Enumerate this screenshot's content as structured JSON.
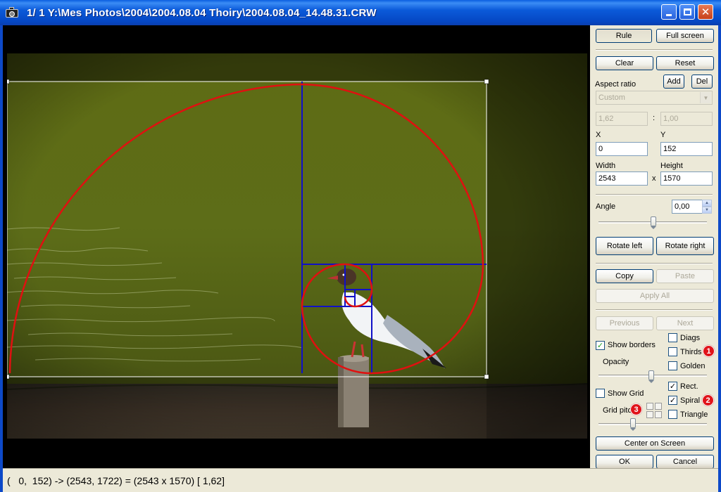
{
  "window": {
    "title": "1/  1  Y:\\Mes Photos\\2004\\2004.08.04 Thoiry\\2004.08.04_14.48.31.CRW",
    "minimize_glyph": "",
    "close_glyph": "✕"
  },
  "panel": {
    "rule_label": "Rule",
    "fullscreen_label": "Full screen",
    "clear_label": "Clear",
    "reset_label": "Reset",
    "aspect_ratio_label": "Aspect ratio",
    "add_label": "Add",
    "del_label": "Del",
    "aspect_select_value": "Custom",
    "ratio_x_value": "1,62",
    "ratio_sep": ":",
    "ratio_y_value": "1,00",
    "x_label": "X",
    "y_label": "Y",
    "x_value": "0",
    "y_value": "152",
    "width_label": "Width",
    "height_label": "Height",
    "width_value": "2543",
    "times_sep": "x",
    "height_value": "1570",
    "angle_label": "Angle",
    "angle_value": "0,00",
    "rotate_left_label": "Rotate left",
    "rotate_right_label": "Rotate right",
    "copy_label": "Copy",
    "paste_label": "Paste",
    "apply_all_label": "Apply All",
    "previous_label": "Previous",
    "next_label": "Next",
    "show_borders_label": "Show borders",
    "show_borders_checked": true,
    "diags_label": "Diags",
    "thirds_label": "Thirds",
    "golden_label": "Golden",
    "opacity_label": "Opacity",
    "rect_label": "Rect.",
    "spiral_label": "Spiral",
    "triangle_label": "Triangle",
    "show_grid_label": "Show Grid",
    "grid_pitch_label": "Grid pitch",
    "center_on_screen_label": "Center on Screen",
    "ok_label": "OK",
    "cancel_label": "Cancel",
    "check_glyph": "✓",
    "badges": [
      "1",
      "2",
      "3"
    ]
  },
  "statusbar": {
    "text": "(   0,  152) -> (2543, 1722) = (2543 x 1570) [ 1,62]"
  },
  "colors": {
    "spiral": "#e01010",
    "golden_rect": "#1010c8",
    "crop_border": "#ffffff",
    "titlebar": "#0b5ad9",
    "badge": "#e0141a"
  }
}
